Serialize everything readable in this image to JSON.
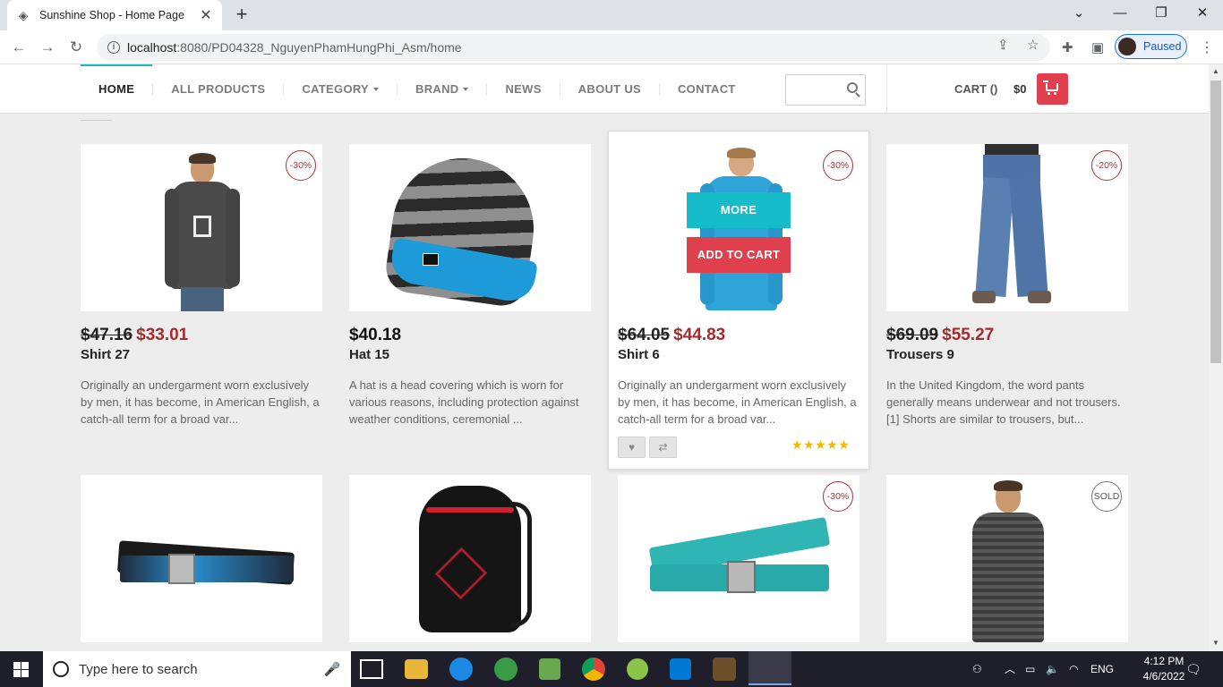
{
  "browser": {
    "tab_title": "Sunshine Shop - Home Page",
    "url_host": "localhost",
    "url_path": ":8080/PD04328_NguyenPhamHungPhi_Asm/home",
    "profile_status": "Paused"
  },
  "nav": {
    "items": [
      {
        "label": "HOME",
        "active": true
      },
      {
        "label": "ALL PRODUCTS"
      },
      {
        "label": "CATEGORY",
        "dropdown": true
      },
      {
        "label": "BRAND",
        "dropdown": true
      },
      {
        "label": "NEWS"
      },
      {
        "label": "ABOUT US"
      },
      {
        "label": "CONTACT"
      }
    ],
    "cart_label": "CART ()",
    "cart_amount": "$0"
  },
  "hover_actions": {
    "more": "MORE",
    "add_to_cart": "ADD TO CART",
    "rating_stars": "★★★★★"
  },
  "products": [
    {
      "name": "Shirt 27",
      "old_price": "$47.16",
      "price": "$33.01",
      "badge": "-30%",
      "desc": "Originally an undergarment worn exclusively by men, it has become, in American English, a catch-all term for a broad var..."
    },
    {
      "name": "Hat 15",
      "old_price": "",
      "price": "$40.18",
      "badge": "",
      "desc": "A hat is a head covering which is worn for various reasons, including protection against weather conditions, ceremonial ..."
    },
    {
      "name": "Shirt 6",
      "old_price": "$64.05",
      "price": "$44.83",
      "badge": "-30%",
      "desc": "Originally an undergarment worn exclusively by men, it has become, in American English, a catch-all term for a broad var..."
    },
    {
      "name": "Trousers 9",
      "old_price": "$69.09",
      "price": "$55.27",
      "badge": "-20%",
      "desc": "In the United Kingdom, the word pants generally means underwear and not trousers. [1] Shorts are similar to trousers, but..."
    },
    {
      "badge": ""
    },
    {
      "badge": ""
    },
    {
      "badge": "-30%"
    },
    {
      "badge": "SOLD"
    }
  ],
  "taskbar": {
    "search_placeholder": "Type here to search",
    "lang": "ENG",
    "time": "4:12 PM",
    "date": "4/6/2022"
  },
  "colors": {
    "accent_teal": "#16bcc9",
    "accent_red": "#e0404e",
    "sale_price": "#a62b2b"
  }
}
